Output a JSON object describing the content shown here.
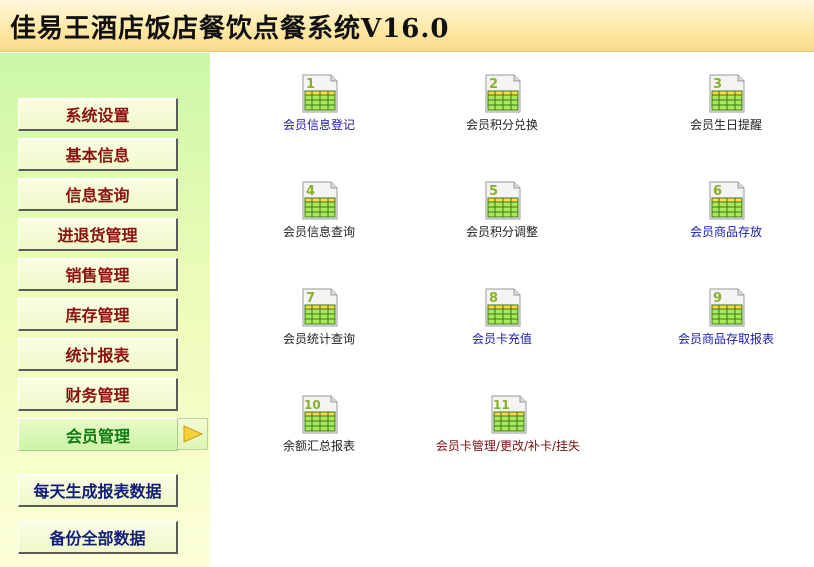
{
  "header": {
    "title": "佳易王酒店饭店餐饮点餐系统V16.0"
  },
  "sidebar": {
    "items": [
      {
        "label": "系统设置"
      },
      {
        "label": "基本信息"
      },
      {
        "label": "信息查询"
      },
      {
        "label": "进退货管理"
      },
      {
        "label": "销售管理"
      },
      {
        "label": "库存管理"
      },
      {
        "label": "统计报表"
      },
      {
        "label": "财务管理"
      },
      {
        "label": "会员管理"
      }
    ],
    "active_index": 8,
    "extra": [
      {
        "label": "每天生成报表数据"
      },
      {
        "label": "备份全部数据"
      }
    ]
  },
  "main": {
    "items": [
      {
        "num": "1",
        "label": "会员信息登记"
      },
      {
        "num": "2",
        "label": "会员积分兑换"
      },
      {
        "num": "3",
        "label": "会员生日提醒"
      },
      {
        "num": "4",
        "label": "会员信息查询"
      },
      {
        "num": "5",
        "label": "会员积分调整"
      },
      {
        "num": "6",
        "label": "会员商品存放"
      },
      {
        "num": "7",
        "label": "会员统计查询"
      },
      {
        "num": "8",
        "label": "会员卡充值"
      },
      {
        "num": "9",
        "label": "会员商品存取报表"
      },
      {
        "num": "10",
        "label": "余额汇总报表"
      },
      {
        "num": "11",
        "label": "会员卡管理/更改/补卡/挂失"
      }
    ]
  },
  "colors": {
    "accent_green": "#0e7a12",
    "nav_text": "#8b1010",
    "link_blue": "#1a1aa8",
    "icon_number": "#8ab02a"
  },
  "icons": {
    "item": "spreadsheet-icon",
    "selection": "arrow-right-icon"
  }
}
